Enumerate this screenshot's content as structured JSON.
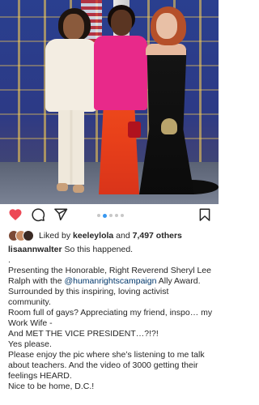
{
  "post": {
    "carousel": {
      "total": 5,
      "active_index": 1
    },
    "likes": {
      "liked_by_prefix": "Liked by",
      "liked_by_user": "keeleylola",
      "and_text": "and",
      "others_count": "7,497 others"
    },
    "caption": {
      "username": "lisaannwalter",
      "first_line": "So this happened.",
      "dot_line": ".",
      "para1_start": "Presenting the Honorable, Right Reverend Sheryl Lee Ralph with the",
      "mention": "@humanrightscampaign",
      "para1_end": "Ally Award. Surrounded by this inspiring, loving activist community.",
      "line_gays": "Room full of gays? Appreciating my friend, inspo… my Work Wife -",
      "line_vp": "And MET THE VICE PRESIDENT…?!?!",
      "line_yes": "Yes please.",
      "line_enjoy": "Please enjoy the pic where she’s listening to me talk about teachers. And the video of 3000 getting their feelings HEARD.",
      "line_home": "Nice to be home, D.C.!"
    }
  },
  "icons": {
    "like": "heart-icon",
    "comment": "comment-icon",
    "share": "send-icon",
    "save": "bookmark-icon"
  },
  "colors": {
    "heart": "#ed4956",
    "active_dot": "#3897f0",
    "mention": "#00376b"
  }
}
